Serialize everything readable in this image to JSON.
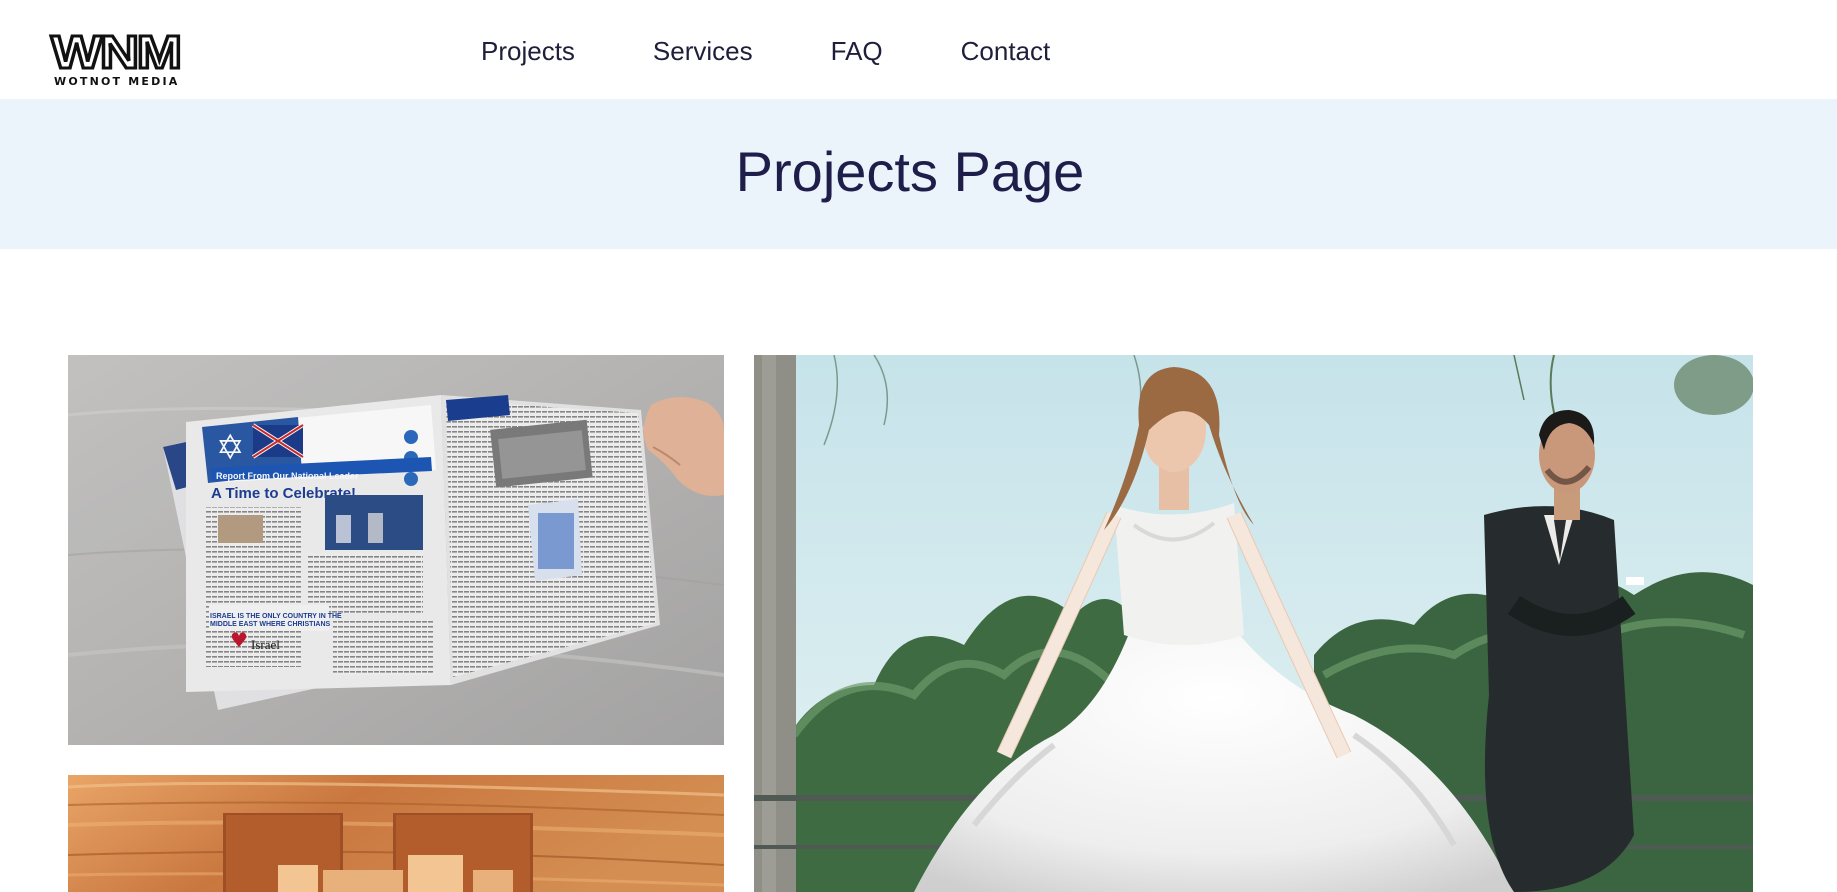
{
  "brand": {
    "logo_mark": "WNM",
    "logo_subtitle": "WOTNOT MEDIA"
  },
  "nav": {
    "items": [
      {
        "label": "Projects"
      },
      {
        "label": "Services"
      },
      {
        "label": "FAQ"
      },
      {
        "label": "Contact"
      }
    ]
  },
  "banner": {
    "title": "Projects Page"
  },
  "gallery": {
    "tiles": [
      {
        "subject": "newspaper-print-project",
        "printed_headline": "A Time to Celebrate!"
      },
      {
        "subject": "engraved-wood-logo-project"
      },
      {
        "subject": "wedding-photo-project"
      }
    ]
  },
  "colors": {
    "nav_text": "#1f1e3b",
    "banner_bg": "#ecf4fb",
    "banner_title": "#1f1e4b"
  }
}
